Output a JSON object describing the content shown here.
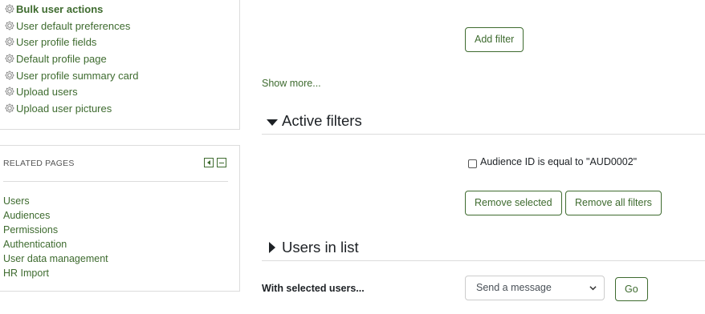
{
  "nav": {
    "items": [
      {
        "label": "Bulk user actions",
        "active": true
      },
      {
        "label": "User default preferences"
      },
      {
        "label": "User profile fields"
      },
      {
        "label": "Default profile page"
      },
      {
        "label": "User profile summary card"
      },
      {
        "label": "Upload users"
      },
      {
        "label": "Upload user pictures"
      }
    ],
    "icon": "gear-icon"
  },
  "related": {
    "title": "RELATED PAGES",
    "controls": [
      "dock-icon",
      "collapse-icon"
    ],
    "links": [
      "Users",
      "Audiences",
      "Permissions",
      "Authentication",
      "User data management",
      "HR Import"
    ]
  },
  "filters": {
    "add_filter_label": "Add filter",
    "show_more_label": "Show more..."
  },
  "active_filters": {
    "heading": "Active filters",
    "expanded": true,
    "items": [
      {
        "label": "Audience ID is equal to \"AUD0002\"",
        "checked": false
      }
    ],
    "remove_selected_label": "Remove selected",
    "remove_all_label": "Remove all filters"
  },
  "users_in_list": {
    "heading": "Users in list",
    "expanded": false
  },
  "bulk": {
    "label": "With selected users...",
    "select_value": "Send a message",
    "go_label": "Go"
  },
  "colors": {
    "accent": "#3e6b2f",
    "text": "#1d2125",
    "border": "#dcdcdc"
  }
}
